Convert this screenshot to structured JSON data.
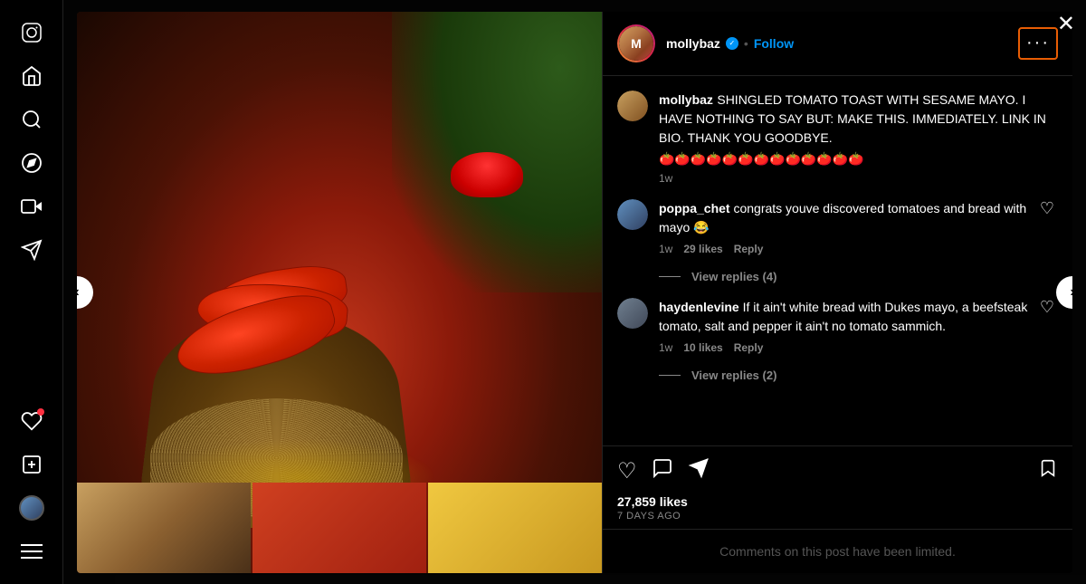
{
  "sidebar": {
    "icons": [
      {
        "name": "instagram-logo-icon",
        "glyph": "📷",
        "label": "Instagram"
      },
      {
        "name": "home-icon",
        "glyph": "⌂",
        "label": "Home"
      },
      {
        "name": "search-icon",
        "glyph": "🔍",
        "label": "Search"
      },
      {
        "name": "explore-icon",
        "glyph": "🧭",
        "label": "Explore"
      },
      {
        "name": "reels-icon",
        "glyph": "▶",
        "label": "Reels"
      },
      {
        "name": "messages-icon",
        "glyph": "✈",
        "label": "Messages"
      },
      {
        "name": "notifications-icon",
        "glyph": "♡",
        "label": "Notifications"
      },
      {
        "name": "create-icon",
        "glyph": "⊕",
        "label": "Create"
      },
      {
        "name": "profile-icon",
        "glyph": "👤",
        "label": "Profile"
      },
      {
        "name": "menu-icon",
        "glyph": "☰",
        "label": "Menu"
      }
    ]
  },
  "modal": {
    "close_label": "✕",
    "nav_left": "‹",
    "nav_right": "›"
  },
  "post": {
    "header": {
      "username": "mollybaz",
      "verified": true,
      "separator": "•",
      "follow_label": "Follow",
      "more_label": "···"
    },
    "original_comment": {
      "username": "mollybaz",
      "text": "SHINGLED TOMATO TOAST WITH SESAME MAYO. I HAVE NOTHING TO SAY BUT: MAKE THIS. IMMEDIATELY. LINK IN BIO. THANK YOU GOODBYE.",
      "emojis": "🍅🍅🍅🍅🍅🍅🍅🍅🍅🍅🍅🍅🍅",
      "time": "1w"
    },
    "comments": [
      {
        "username": "poppa_chet",
        "text": "congrats youve discovered tomatoes and bread with mayo 😂",
        "time": "1w",
        "likes": "29 likes",
        "replies_count": "4",
        "replies_label": "View replies (4)"
      },
      {
        "username": "haydenlevine",
        "text": "If it ain't white bread with Dukes mayo, a beefsteak tomato, salt and pepper it ain't no tomato sammich.",
        "time": "1w",
        "likes": "10 likes",
        "replies_count": "2",
        "replies_label": "View replies (2)"
      }
    ],
    "actions": {
      "like_icon": "♡",
      "comment_icon": "💬",
      "share_icon": "✈",
      "bookmark_icon": "🔖",
      "likes_count": "27,859 likes",
      "time_ago": "7 DAYS AGO"
    },
    "limited_comments": "Comments on this post have been limited."
  }
}
